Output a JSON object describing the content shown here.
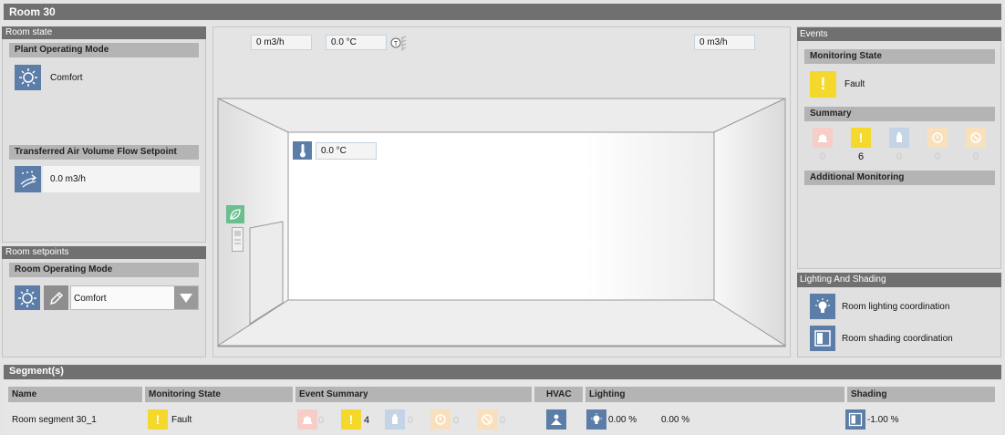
{
  "title": "Room 30",
  "room_state": {
    "header": "Room state",
    "plant_mode": {
      "label": "Plant Operating Mode",
      "value": "Comfort",
      "icon": "sun-icon"
    },
    "air_flow": {
      "label": "Transferred Air Volume Flow Setpoint",
      "value": "0.0 m3/h",
      "icon": "airflow-icon"
    }
  },
  "room_setpoints": {
    "header": "Room setpoints",
    "operating_mode": {
      "label": "Room Operating Mode",
      "value": "Comfort"
    }
  },
  "room_view": {
    "supply_flow": "0 m3/h",
    "supply_temp": "0.0 °C",
    "thermostat_icon_label": "T",
    "exhaust_flow": "0 m3/h",
    "room_temp": "0.0 °C"
  },
  "events": {
    "header": "Events",
    "monitoring_state": {
      "label": "Monitoring State",
      "value": "Fault"
    },
    "summary": {
      "label": "Summary",
      "items": [
        {
          "icon": "alarm-icon",
          "count": "0",
          "active": false,
          "color": "#f2a39a"
        },
        {
          "icon": "fault-icon",
          "count": "6",
          "active": true,
          "color": "#f5d82c"
        },
        {
          "icon": "maintenance-icon",
          "count": "0",
          "active": false,
          "color": "#a6bcd7"
        },
        {
          "icon": "info-icon",
          "count": "0",
          "active": false,
          "color": "#f6cf9c"
        },
        {
          "icon": "disabled-icon",
          "count": "0",
          "active": false,
          "color": "#f6cf9c"
        }
      ]
    },
    "additional": {
      "label": "Additional Monitoring"
    }
  },
  "lighting_shading": {
    "header": "Lighting And Shading",
    "lighting": "Room lighting coordination",
    "shading": "Room shading coordination"
  },
  "segments": {
    "header": "Segment(s)",
    "columns": [
      "Name",
      "Monitoring State",
      "Event Summary",
      "HVAC",
      "Lighting",
      "Shading"
    ],
    "rows": [
      {
        "name": "Room segment 30_1",
        "monitoring_state": "Fault",
        "events": [
          {
            "icon": "alarm-icon",
            "count": "0",
            "active": false
          },
          {
            "icon": "fault-icon",
            "count": "4",
            "active": true
          },
          {
            "icon": "maintenance-icon",
            "count": "0",
            "active": false
          },
          {
            "icon": "info-icon",
            "count": "0",
            "active": false
          },
          {
            "icon": "disabled-icon",
            "count": "0",
            "active": false
          }
        ],
        "lighting_1": "0.00 %",
        "lighting_2": "0.00 %",
        "shading": "-1.00 %"
      }
    ]
  }
}
